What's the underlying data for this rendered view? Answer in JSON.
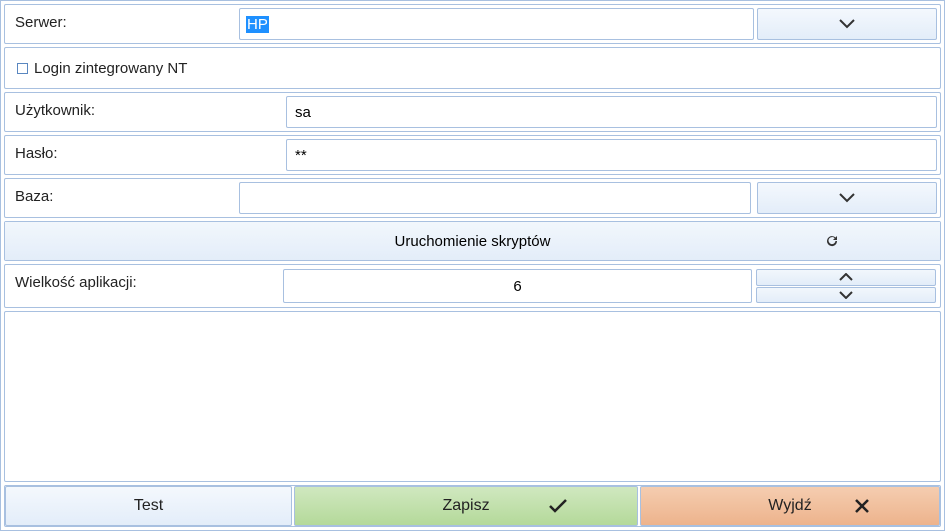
{
  "labels": {
    "server": "Serwer:",
    "integrated_login": "Login zintegrowany NT",
    "user": "Użytkownik:",
    "password": "Hasło:",
    "database": "Baza:",
    "run_scripts": "Uruchomienie skryptów",
    "app_size": "Wielkość aplikacji:"
  },
  "values": {
    "server": "HP",
    "integrated_login_checked": false,
    "user": "sa",
    "password": "**",
    "database": "",
    "app_size": "6"
  },
  "footer": {
    "test": "Test",
    "save": "Zapisz",
    "exit": "Wyjdź"
  }
}
